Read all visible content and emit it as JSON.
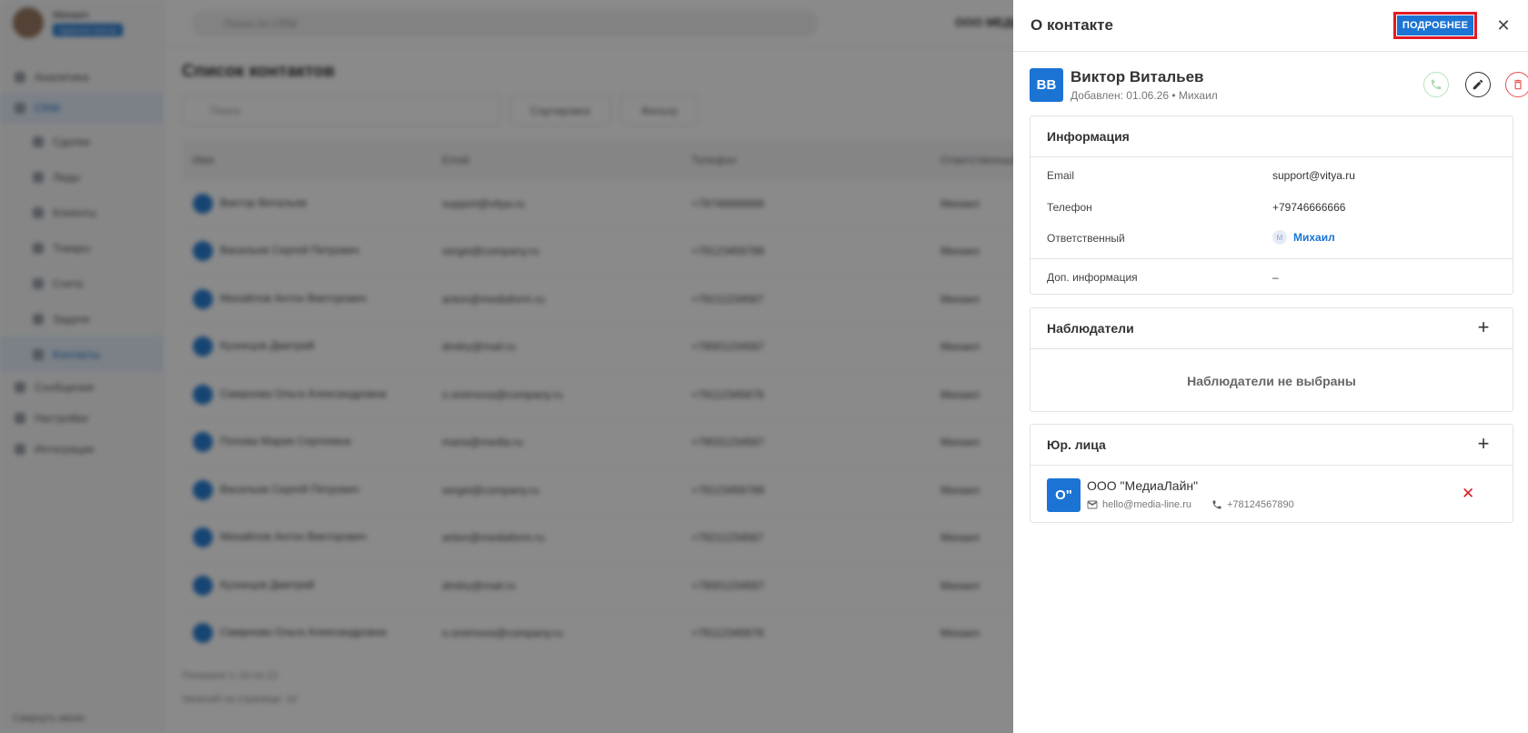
{
  "background": {
    "user": {
      "name": "Михаил",
      "role": "Администратор"
    },
    "nav": [
      "Аналитика",
      "CRM",
      "Сделки",
      "Лиды",
      "Клиенты",
      "Товары",
      "Счета",
      "Задачи",
      "Контакты",
      "Сообщения",
      "Настройки",
      "Интеграции"
    ],
    "sidebar_footer": "Свернуть меню",
    "search_placeholder": "Поиск по CRM",
    "company": "ООО МЕДИАЛАЙН",
    "page_title": "Список контактов",
    "filter_placeholder": "Поиск",
    "sort_label": "Сортировка",
    "filter_label": "Фильтр",
    "columns": [
      "Имя",
      "Email",
      "Телефон",
      "Ответственный"
    ],
    "rows": [
      [
        "Виктор Витальев",
        "support@vitya.ru",
        "+79746666666",
        "Михаил"
      ],
      [
        "Васильев Сергей Петрович",
        "sergei@company.ru",
        "+79123456789",
        "Михаил"
      ],
      [
        "Михайлов Антон Викторович",
        "anton@mediaform.ru",
        "+79211234567",
        "Михаил"
      ],
      [
        "Кузнецов Дмитрий",
        "dmitry@mail.ru",
        "+79001234567",
        "Михаил"
      ],
      [
        "Смирнова Ольга Александровна",
        "o.smirnova@company.ru",
        "+79112345678",
        "Михаил"
      ],
      [
        "Попова Мария Сергеевна",
        "maria@media.ru",
        "+79031234567",
        "Михаил"
      ],
      [
        "Васильев Сергей Петрович",
        "sergei@company.ru",
        "+79123456789",
        "Михаил"
      ],
      [
        "Михайлов Антон Викторович",
        "anton@mediaform.ru",
        "+79211234567",
        "Михаил"
      ],
      [
        "Кузнецов Дмитрий",
        "dmitry@mail.ru",
        "+79001234567",
        "Михаил"
      ],
      [
        "Смирнова Ольга Александровна",
        "o.smirnova@company.ru",
        "+79112345678",
        "Михаил"
      ]
    ],
    "pager": "Показано 1–10 из 12",
    "per_page": "Записей на странице: 10"
  },
  "drawer": {
    "title": "О контакте",
    "details_button": "ПОДРОБНЕЕ",
    "close_glyph": "✕",
    "contact": {
      "initials": "ВВ",
      "name": "Виктор Витальев",
      "meta": "Добавлен: 01.06.26 • Михаил"
    },
    "info": {
      "title": "Информация",
      "email_label": "Email",
      "email_value": "support@vitya.ru",
      "phone_label": "Телефон",
      "phone_value": "+79746666666",
      "owner_label": "Ответственный",
      "owner_initial": "М",
      "owner_value": "Михаил",
      "extra_label": "Доп. информация",
      "extra_value": "–"
    },
    "watchers": {
      "title": "Наблюдатели",
      "empty": "Наблюдатели не выбраны"
    },
    "legal": {
      "title": "Юр. лица",
      "initials": "О\"",
      "name": "ООО \"МедиаЛайн\"",
      "email": "hello@media-line.ru",
      "phone": "+78124567890"
    },
    "colors": {
      "accent": "#1b74d4",
      "danger": "#e01b24",
      "call": "#4caf50"
    }
  }
}
